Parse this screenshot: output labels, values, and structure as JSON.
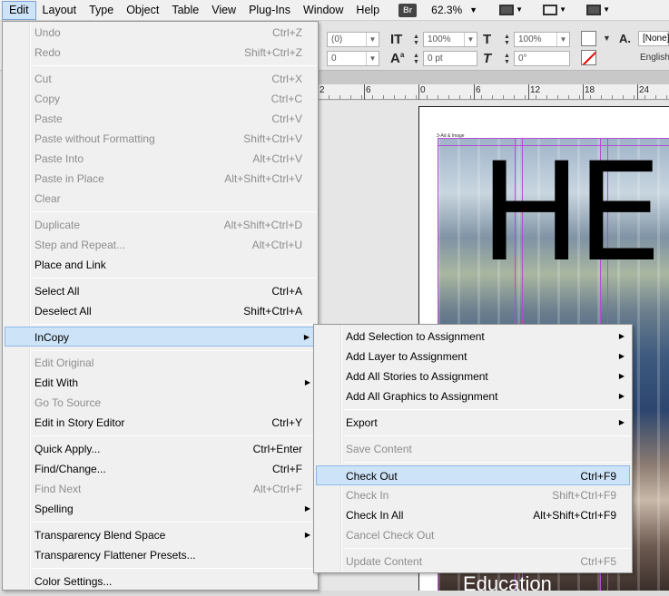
{
  "menubar": {
    "items": [
      "Edit",
      "Layout",
      "Type",
      "Object",
      "Table",
      "View",
      "Plug-Ins",
      "Window",
      "Help"
    ],
    "bridge_label": "Br",
    "zoom": "62.3%"
  },
  "control_panel": {
    "field1": "(0)",
    "field2": "0",
    "scale1": "100%",
    "baseline": "0 pt",
    "scale2": "100%",
    "skew": "0°",
    "style": "[None]",
    "language": "English"
  },
  "ruler": {
    "labels": [
      "2",
      "6",
      "0",
      "6",
      "12",
      "18",
      "24"
    ]
  },
  "document": {
    "title_text": "HE",
    "caption_text": "Education",
    "tiny_label": "3-Ad & Image"
  },
  "edit_menu": {
    "undo": {
      "label": "Undo",
      "shortcut": "Ctrl+Z"
    },
    "redo": {
      "label": "Redo",
      "shortcut": "Shift+Ctrl+Z"
    },
    "cut": {
      "label": "Cut",
      "shortcut": "Ctrl+X"
    },
    "copy": {
      "label": "Copy",
      "shortcut": "Ctrl+C"
    },
    "paste": {
      "label": "Paste",
      "shortcut": "Ctrl+V"
    },
    "paste_without_formatting": {
      "label": "Paste without Formatting",
      "shortcut": "Shift+Ctrl+V"
    },
    "paste_into": {
      "label": "Paste Into",
      "shortcut": "Alt+Ctrl+V"
    },
    "paste_in_place": {
      "label": "Paste in Place",
      "shortcut": "Alt+Shift+Ctrl+V"
    },
    "clear": {
      "label": "Clear",
      "shortcut": ""
    },
    "duplicate": {
      "label": "Duplicate",
      "shortcut": "Alt+Shift+Ctrl+D"
    },
    "step_and_repeat": {
      "label": "Step and Repeat...",
      "shortcut": "Alt+Ctrl+U"
    },
    "place_and_link": {
      "label": "Place and Link",
      "shortcut": ""
    },
    "select_all": {
      "label": "Select All",
      "shortcut": "Ctrl+A"
    },
    "deselect_all": {
      "label": "Deselect All",
      "shortcut": "Shift+Ctrl+A"
    },
    "incopy": {
      "label": "InCopy",
      "shortcut": ""
    },
    "edit_original": {
      "label": "Edit Original",
      "shortcut": ""
    },
    "edit_with": {
      "label": "Edit With",
      "shortcut": ""
    },
    "go_to_source": {
      "label": "Go To Source",
      "shortcut": ""
    },
    "edit_in_story_editor": {
      "label": "Edit in Story Editor",
      "shortcut": "Ctrl+Y"
    },
    "quick_apply": {
      "label": "Quick Apply...",
      "shortcut": "Ctrl+Enter"
    },
    "find_change": {
      "label": "Find/Change...",
      "shortcut": "Ctrl+F"
    },
    "find_next": {
      "label": "Find Next",
      "shortcut": "Alt+Ctrl+F"
    },
    "spelling": {
      "label": "Spelling",
      "shortcut": ""
    },
    "transparency_blend_space": {
      "label": "Transparency Blend Space",
      "shortcut": ""
    },
    "transparency_flattener_presets": {
      "label": "Transparency Flattener Presets...",
      "shortcut": ""
    },
    "color_settings": {
      "label": "Color Settings...",
      "shortcut": ""
    }
  },
  "incopy_menu": {
    "add_selection": {
      "label": "Add Selection to Assignment",
      "shortcut": ""
    },
    "add_layer": {
      "label": "Add Layer to Assignment",
      "shortcut": ""
    },
    "add_all_stories": {
      "label": "Add All Stories to Assignment",
      "shortcut": ""
    },
    "add_all_graphics": {
      "label": "Add All Graphics to Assignment",
      "shortcut": ""
    },
    "export": {
      "label": "Export",
      "shortcut": ""
    },
    "save_content": {
      "label": "Save Content",
      "shortcut": ""
    },
    "check_out": {
      "label": "Check Out",
      "shortcut": "Ctrl+F9"
    },
    "check_in": {
      "label": "Check In",
      "shortcut": "Shift+Ctrl+F9"
    },
    "check_in_all": {
      "label": "Check In All",
      "shortcut": "Alt+Shift+Ctrl+F9"
    },
    "cancel_check_out": {
      "label": "Cancel Check Out",
      "shortcut": ""
    },
    "update_content": {
      "label": "Update Content",
      "shortcut": "Ctrl+F5"
    }
  },
  "icons": {
    "submenu_arrow": "▶",
    "dropdown_arrow": "▼"
  }
}
